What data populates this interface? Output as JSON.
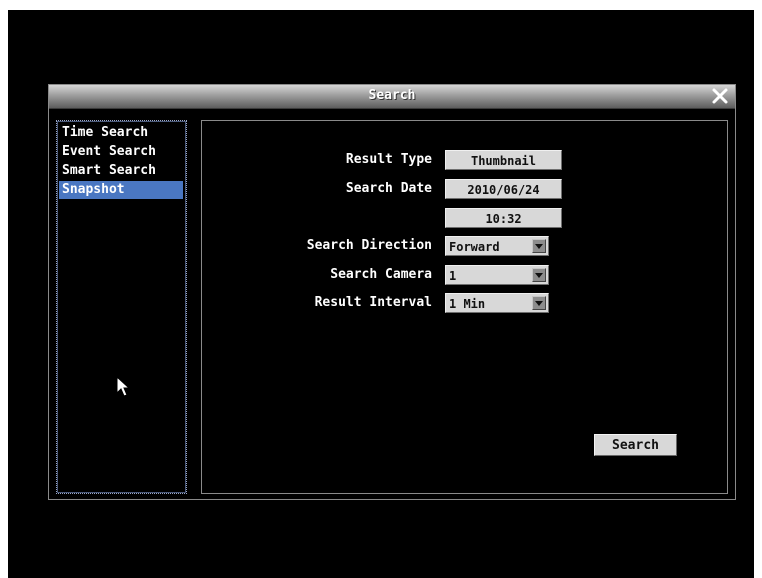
{
  "dialog": {
    "title": "Search",
    "close_icon": "close-icon"
  },
  "sidebar": {
    "items": [
      {
        "label": "Time Search",
        "selected": false
      },
      {
        "label": "Event Search",
        "selected": false
      },
      {
        "label": "Smart Search",
        "selected": false
      },
      {
        "label": "Snapshot",
        "selected": true
      }
    ]
  },
  "form": {
    "result_type": {
      "label": "Result Type",
      "value": "Thumbnail"
    },
    "search_date": {
      "label": "Search Date",
      "date": "2010/06/24",
      "time": "10:32"
    },
    "search_direction": {
      "label": "Search Direction",
      "value": "Forward"
    },
    "search_camera": {
      "label": "Search Camera",
      "value": "1"
    },
    "result_interval": {
      "label": "Result Interval",
      "value": "1 Min"
    }
  },
  "actions": {
    "search_label": "Search"
  },
  "colors": {
    "selection": "#4a77c2",
    "background": "#000000",
    "field": "#d8d8d8"
  }
}
